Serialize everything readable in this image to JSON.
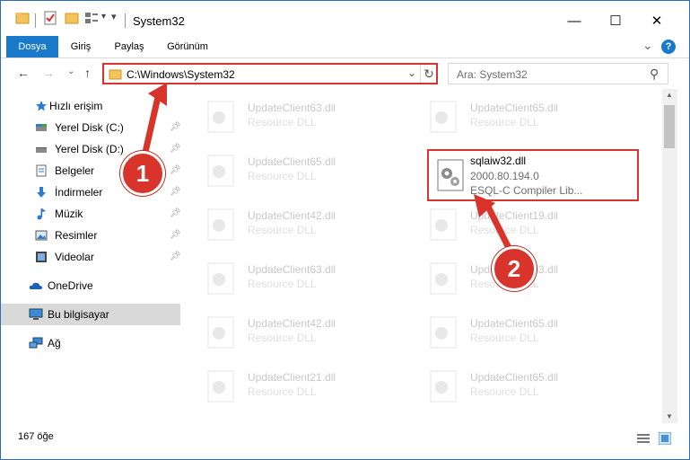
{
  "window": {
    "title": "System32",
    "minimize": "—",
    "maximize": "☐",
    "close": "✕"
  },
  "ribbon": {
    "tabs": [
      "Dosya",
      "Giriş",
      "Paylaş",
      "Görünüm"
    ],
    "expand": "⌄",
    "help": "?"
  },
  "nav": {
    "back": "←",
    "forward": "→",
    "recent": "⌄",
    "up": "↑",
    "address": "C:\\Windows\\System32",
    "address_dropdown": "⌄",
    "refresh": "↻",
    "search_placeholder": "Ara: System32",
    "search_icon": "⚲"
  },
  "sidebar": {
    "items": [
      {
        "label": "Hızlı erişim",
        "icon": "star-icon"
      },
      {
        "label": "Yerel Disk (C:)",
        "icon": "drive-icon"
      },
      {
        "label": "Yerel Disk (D:)",
        "icon": "drive-icon"
      },
      {
        "label": "Belgeler",
        "icon": "documents-icon"
      },
      {
        "label": "İndirmeler",
        "icon": "download-icon"
      },
      {
        "label": "Müzik",
        "icon": "music-icon"
      },
      {
        "label": "Resimler",
        "icon": "pictures-icon"
      },
      {
        "label": "Videolar",
        "icon": "video-icon"
      },
      {
        "label": "OneDrive",
        "icon": "cloud-icon"
      },
      {
        "label": "Bu bilgisayar",
        "icon": "computer-icon"
      },
      {
        "label": "Ağ",
        "icon": "network-icon"
      }
    ]
  },
  "files": [
    {
      "name": "UpdateClient63.dll",
      "desc": "Resource DLL"
    },
    {
      "name": "UpdateClient65.dll",
      "desc": "Resource DLL"
    },
    {
      "name": "UpdateClient65.dll",
      "desc": "Resource DLL"
    },
    {
      "name": "UpdateClient42.dll",
      "desc": "Resource DLL"
    },
    {
      "name": "UpdateClient19.dll",
      "desc": "Resource DLL"
    },
    {
      "name": "UpdateClient63.dll",
      "desc": "Resource DLL"
    },
    {
      "name": "UpdateClient63.dll",
      "desc": "Resource DLL"
    },
    {
      "name": "UpdateClient42.dll",
      "desc": "Resource DLL"
    },
    {
      "name": "UpdateClient65.dll",
      "desc": "Resource DLL"
    },
    {
      "name": "UpdateClient21.dll",
      "desc": "Resource DLL"
    },
    {
      "name": "UpdateClient65.dll",
      "desc": "Resource DLL"
    }
  ],
  "selected_file": {
    "name": "sqlaiw32.dll",
    "version": "2000.80.194.0",
    "desc": "ESQL-C Compiler Lib..."
  },
  "status": {
    "count": "167 öğe"
  },
  "annotations": {
    "step1": "1",
    "step2": "2"
  },
  "colors": {
    "accent": "#1979ca",
    "highlight": "#d9342b"
  }
}
